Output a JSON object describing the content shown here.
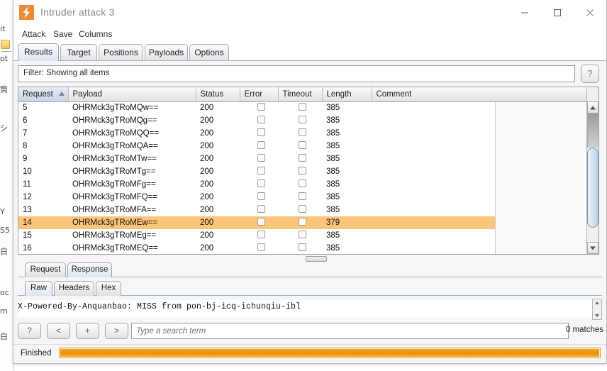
{
  "window": {
    "title": "Intruder attack 3",
    "app_icon": "burp-lightning-icon",
    "minimize_label": "minimize-icon",
    "maximize_label": "maximize-icon",
    "close_label": "close-icon"
  },
  "menubar": {
    "items": [
      {
        "label": "Attack"
      },
      {
        "label": "Save"
      },
      {
        "label": "Columns"
      }
    ]
  },
  "tabs": {
    "items": [
      {
        "label": "Results",
        "active": true
      },
      {
        "label": "Target",
        "active": false
      },
      {
        "label": "Positions",
        "active": false
      },
      {
        "label": "Payloads",
        "active": false
      },
      {
        "label": "Options",
        "active": false
      }
    ]
  },
  "filter": {
    "label": "Filter:  Showing all items",
    "help_label": "?"
  },
  "results_table": {
    "columns": [
      "Request",
      "Payload",
      "Status",
      "Error",
      "Timeout",
      "Length",
      "Comment"
    ],
    "sorted_column": "Request",
    "sort_direction": "ascending",
    "rows": [
      {
        "request": "5",
        "payload": "OHRMck3gTRoMQw==",
        "status": "200",
        "error": false,
        "timeout": false,
        "length": "385",
        "comment": "",
        "selected": false
      },
      {
        "request": "6",
        "payload": "OHRMck3gTRoMQg==",
        "status": "200",
        "error": false,
        "timeout": false,
        "length": "385",
        "comment": "",
        "selected": false
      },
      {
        "request": "7",
        "payload": "OHRMck3gTRoMQQ==",
        "status": "200",
        "error": false,
        "timeout": false,
        "length": "385",
        "comment": "",
        "selected": false
      },
      {
        "request": "8",
        "payload": "OHRMck3gTRoMQA==",
        "status": "200",
        "error": false,
        "timeout": false,
        "length": "385",
        "comment": "",
        "selected": false
      },
      {
        "request": "9",
        "payload": "OHRMck3gTRoMTw==",
        "status": "200",
        "error": false,
        "timeout": false,
        "length": "385",
        "comment": "",
        "selected": false
      },
      {
        "request": "10",
        "payload": "OHRMck3gTRoMTg==",
        "status": "200",
        "error": false,
        "timeout": false,
        "length": "385",
        "comment": "",
        "selected": false
      },
      {
        "request": "11",
        "payload": "OHRMck3gTRoMFg==",
        "status": "200",
        "error": false,
        "timeout": false,
        "length": "385",
        "comment": "",
        "selected": false
      },
      {
        "request": "12",
        "payload": "OHRMck3gTRoMFQ==",
        "status": "200",
        "error": false,
        "timeout": false,
        "length": "385",
        "comment": "",
        "selected": false
      },
      {
        "request": "13",
        "payload": "OHRMck3gTRoMFA==",
        "status": "200",
        "error": false,
        "timeout": false,
        "length": "385",
        "comment": "",
        "selected": false
      },
      {
        "request": "14",
        "payload": "OHRMck3gTRoMEw==",
        "status": "200",
        "error": false,
        "timeout": false,
        "length": "379",
        "comment": "",
        "selected": true
      },
      {
        "request": "15",
        "payload": "OHRMck3gTRoMEg==",
        "status": "200",
        "error": false,
        "timeout": false,
        "length": "385",
        "comment": "",
        "selected": false
      },
      {
        "request": "16",
        "payload": "OHRMck3gTRoMEQ==",
        "status": "200",
        "error": false,
        "timeout": false,
        "length": "385",
        "comment": "",
        "selected": false
      }
    ]
  },
  "message_tabs": {
    "items": [
      {
        "label": "Request",
        "active": false
      },
      {
        "label": "Response",
        "active": true
      }
    ]
  },
  "view_tabs": {
    "items": [
      {
        "label": "Raw",
        "active": true
      },
      {
        "label": "Headers",
        "active": false
      },
      {
        "label": "Hex",
        "active": false
      }
    ]
  },
  "response": {
    "body": "X-Powered-By-Anquanbao: MISS from pon-bj-icq-ichunqiu-ibl"
  },
  "search": {
    "buttons": [
      {
        "label": "?",
        "name": "help"
      },
      {
        "label": "<",
        "name": "previous"
      },
      {
        "label": "+",
        "name": "add"
      },
      {
        "label": ">",
        "name": "next"
      }
    ],
    "placeholder": "Type a search term",
    "value": "",
    "matches": "0 matches"
  },
  "status": {
    "text": "Finished",
    "progress_percent": 100
  },
  "colors": {
    "accent_orange": "#ec8a33",
    "selection": "#fbc67a",
    "progress": "#ef8f05",
    "tab_active": "#dde6f1"
  },
  "background_window": {
    "fragments": [
      "it",
      "ot",
      "筒",
      "シ",
      "Y",
      "S5",
      "oc",
      "m",
      "白"
    ]
  }
}
